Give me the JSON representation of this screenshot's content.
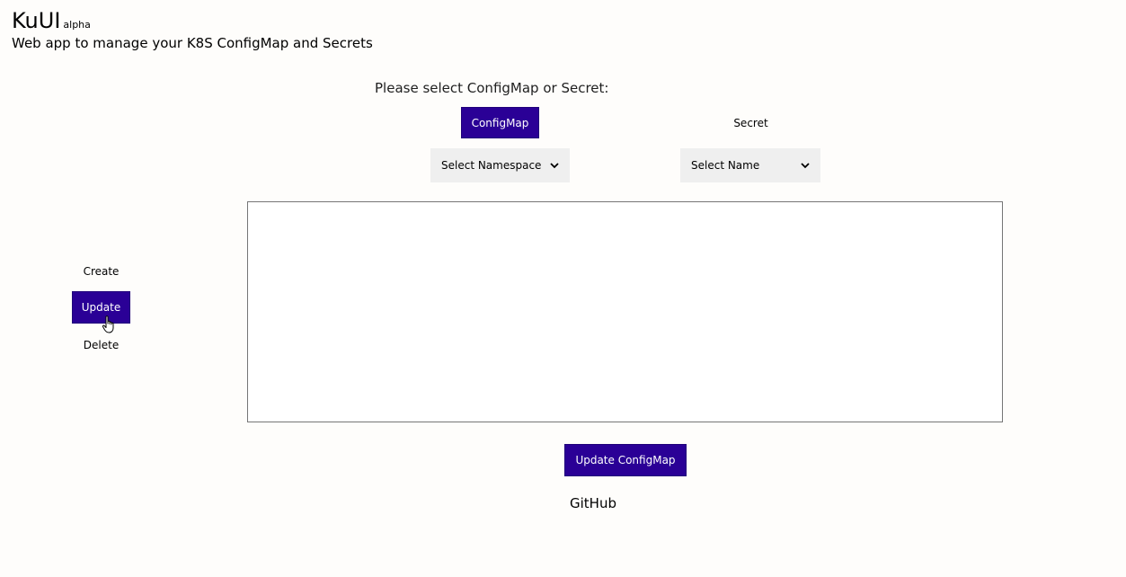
{
  "header": {
    "brand": "KuUI",
    "brand_tag": "alpha",
    "subtitle": "Web app to manage your K8S ConfigMap and Secrets"
  },
  "selector": {
    "prompt": "Please select ConfigMap or Secret:",
    "types": [
      {
        "label": "ConfigMap",
        "active": true
      },
      {
        "label": "Secret",
        "active": false
      }
    ],
    "namespace_select": "Select Namespace",
    "name_select": "Select Name"
  },
  "actions": {
    "create": "Create",
    "update": "Update",
    "delete": "Delete",
    "active": "Update"
  },
  "editor": {
    "value": ""
  },
  "submit": {
    "label": "Update ConfigMap"
  },
  "footer": {
    "github": "GitHub"
  },
  "colors": {
    "accent": "#2a0096",
    "background": "#fefdfb",
    "select_bg": "#efefef"
  },
  "icons": [
    "chevron-down-icon",
    "hand-pointer-icon"
  ]
}
